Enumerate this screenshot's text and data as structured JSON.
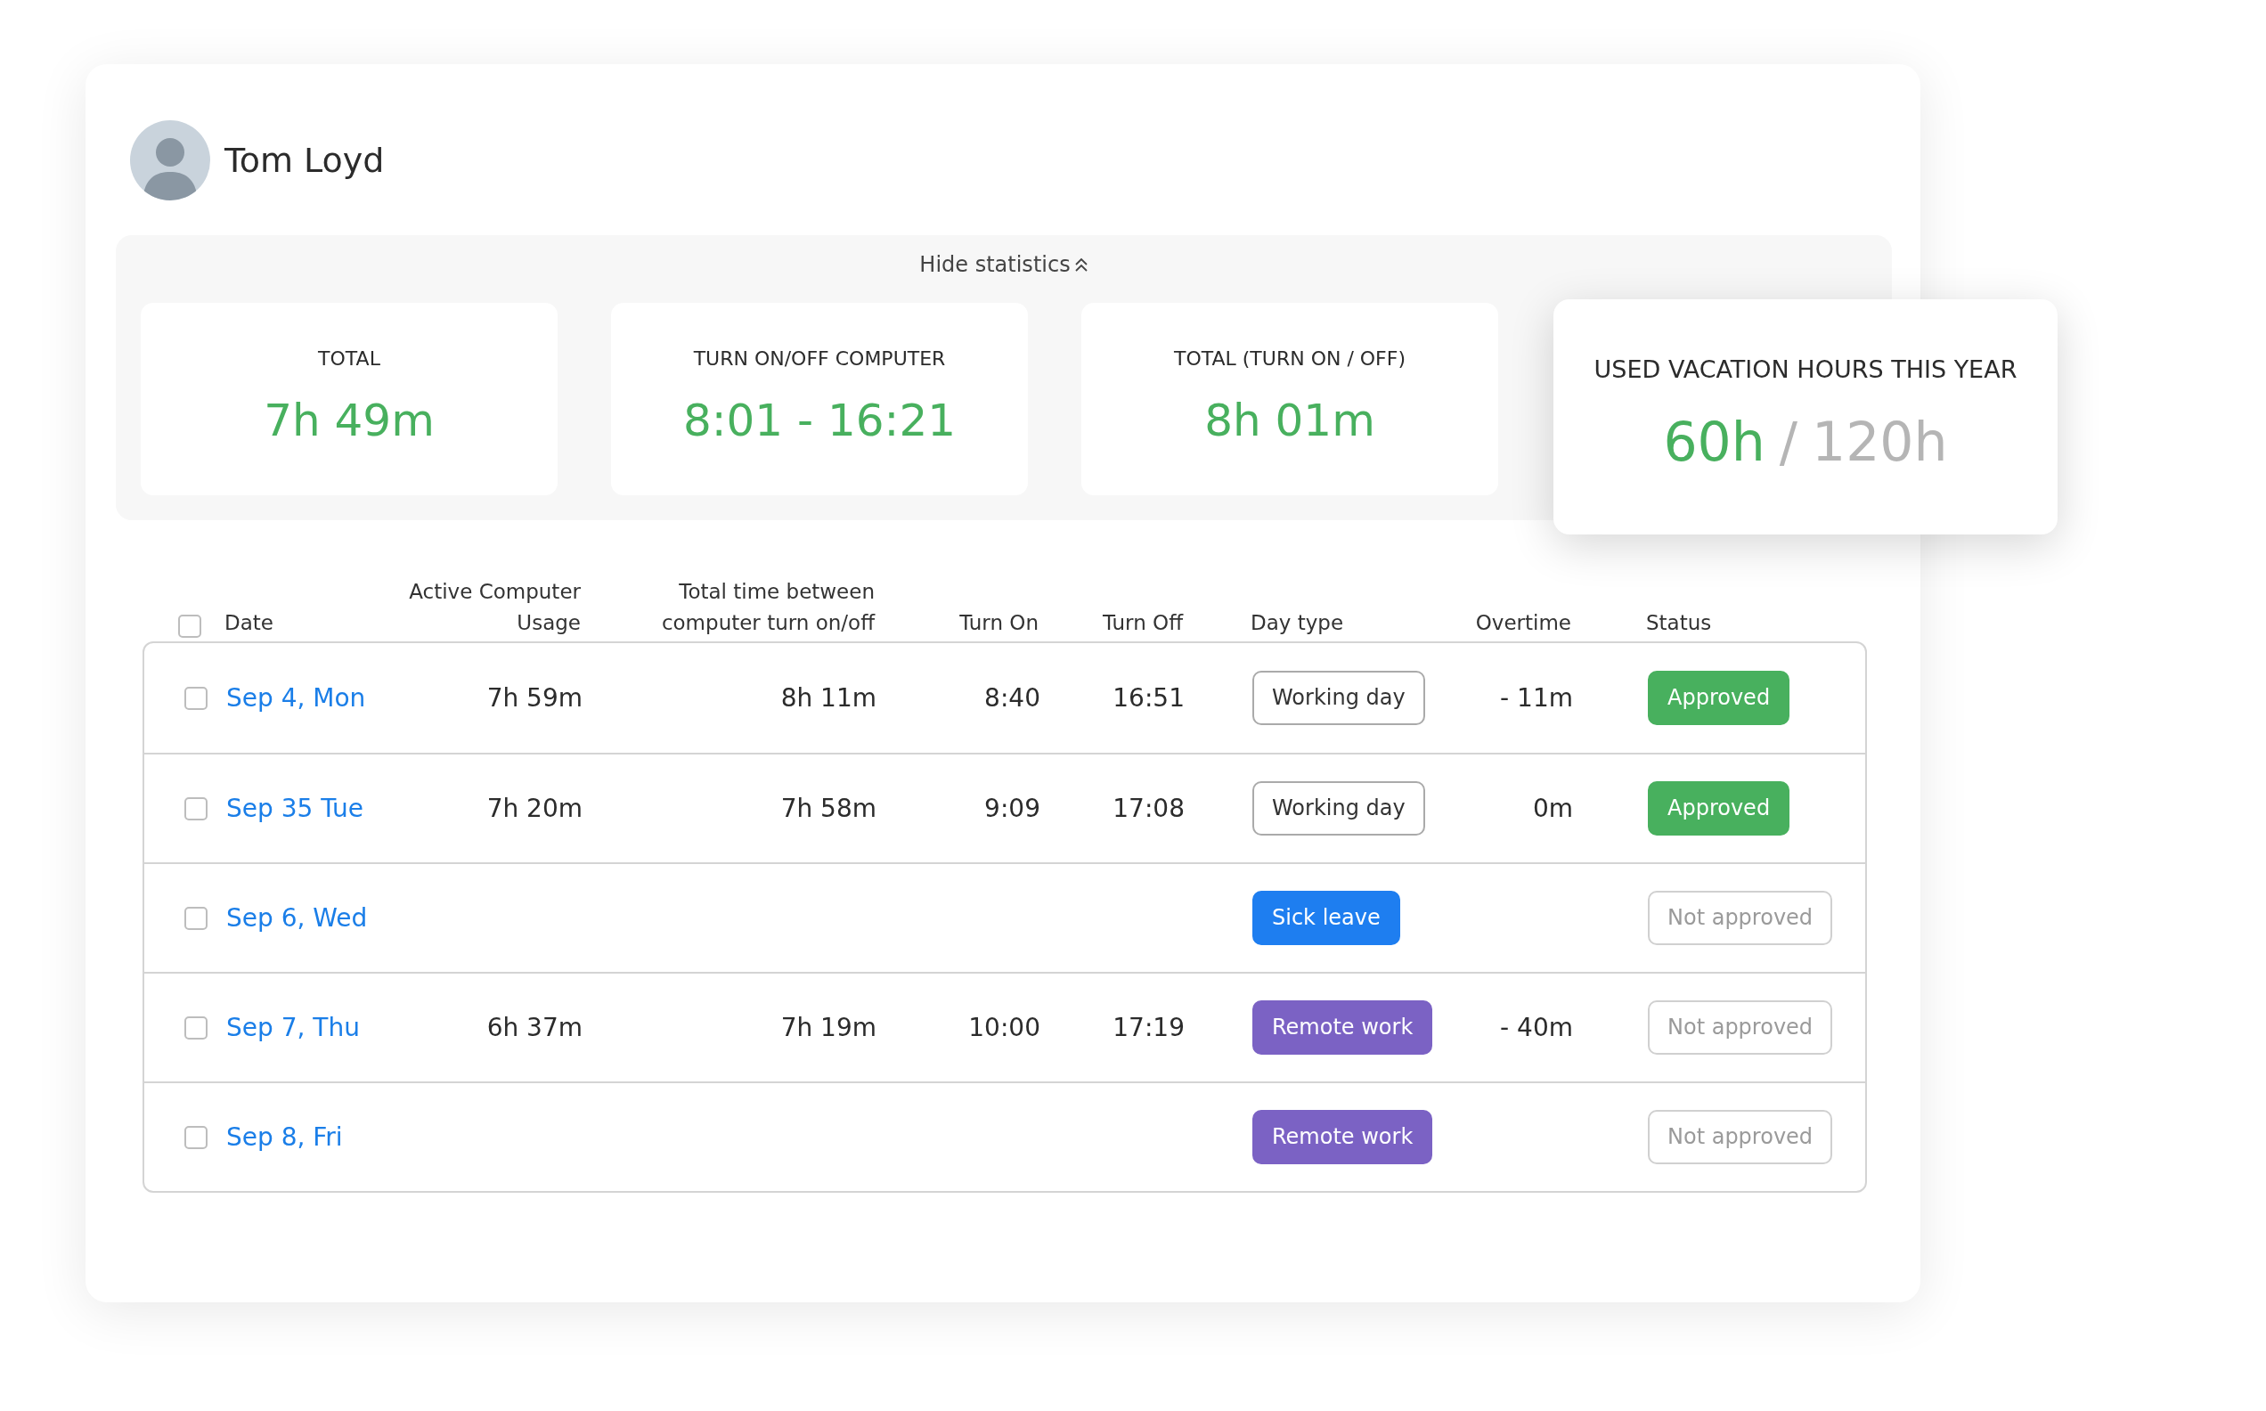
{
  "user": {
    "name": "Tom Loyd"
  },
  "statistics": {
    "toggle_label": "Hide statistics",
    "expanded": true,
    "cards": [
      {
        "label": "TOTAL",
        "value": "7h 49m"
      },
      {
        "label": "TURN ON/OFF COMPUTER",
        "value": "8:01 - 16:21"
      },
      {
        "label": "TOTAL (TURN ON / OFF)",
        "value": "8h 01m"
      }
    ]
  },
  "vacation": {
    "label": "USED VACATION HOURS THIS YEAR",
    "used": "60h",
    "separator": "/",
    "total": "120h"
  },
  "table": {
    "select_all_checked": false,
    "columns": [
      "Date",
      "Active Computer Usage",
      "Total time between computer turn on/off",
      "Turn On",
      "Turn Off",
      "Day type",
      "Overtime",
      "Status"
    ],
    "rows": [
      {
        "checked": false,
        "date": "Sep 4, Mon",
        "active_usage": "7h 59m",
        "total_time": "8h 11m",
        "turn_on": "8:40",
        "turn_off": "16:51",
        "day_type": {
          "kind": "working",
          "label": "Working day"
        },
        "overtime": "- 11m",
        "status": {
          "approved": true,
          "label": "Approved"
        }
      },
      {
        "checked": false,
        "date": "Sep  35 Tue",
        "active_usage": "7h 20m",
        "total_time": "7h 58m",
        "turn_on": "9:09",
        "turn_off": "17:08",
        "day_type": {
          "kind": "working",
          "label": "Working day"
        },
        "overtime": "0m",
        "status": {
          "approved": true,
          "label": "Approved"
        }
      },
      {
        "checked": false,
        "date": "Sep 6, Wed",
        "day_type": {
          "kind": "sick",
          "label": "Sick leave"
        },
        "status": {
          "approved": false,
          "label": "Not approved"
        }
      },
      {
        "checked": false,
        "date": "Sep 7, Thu",
        "active_usage": "6h 37m",
        "total_time": "7h 19m",
        "turn_on": "10:00",
        "turn_off": "17:19",
        "day_type": {
          "kind": "remote",
          "label": "Remote work"
        },
        "overtime": "- 40m",
        "status": {
          "approved": false,
          "label": "Not approved"
        }
      },
      {
        "checked": false,
        "date": "Sep 8, Fri",
        "day_type": {
          "kind": "remote",
          "label": "Remote work"
        },
        "status": {
          "approved": false,
          "label": "Not approved"
        }
      }
    ]
  }
}
